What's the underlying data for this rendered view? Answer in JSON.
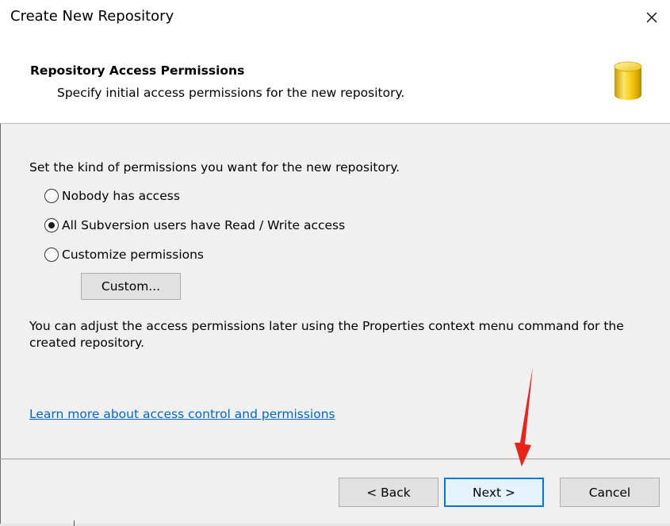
{
  "window": {
    "title": "Create New Repository",
    "close_symbol": "×"
  },
  "header": {
    "title": "Repository Access Permissions",
    "subtitle": "Specify initial access permissions for the new repository.",
    "icon": "database-cylinder-icon"
  },
  "content": {
    "instruction": "Set the kind of permissions you want for the new repository.",
    "options": [
      {
        "label": "Nobody has access",
        "checked": false
      },
      {
        "label": "All Subversion users have Read / Write access",
        "checked": true
      },
      {
        "label": "Customize permissions",
        "checked": false
      }
    ],
    "custom_button_label": "Custom...",
    "note": "You can adjust the access permissions later using the Properties context menu command for the created repository.",
    "link_text": "Learn more about access control and permissions"
  },
  "footer": {
    "back_label": "< Back",
    "next_label": "Next >",
    "cancel_label": "Cancel"
  },
  "colors": {
    "accent": "#0078d7",
    "link": "#0066cc",
    "annotation_arrow": "#e8231a"
  }
}
